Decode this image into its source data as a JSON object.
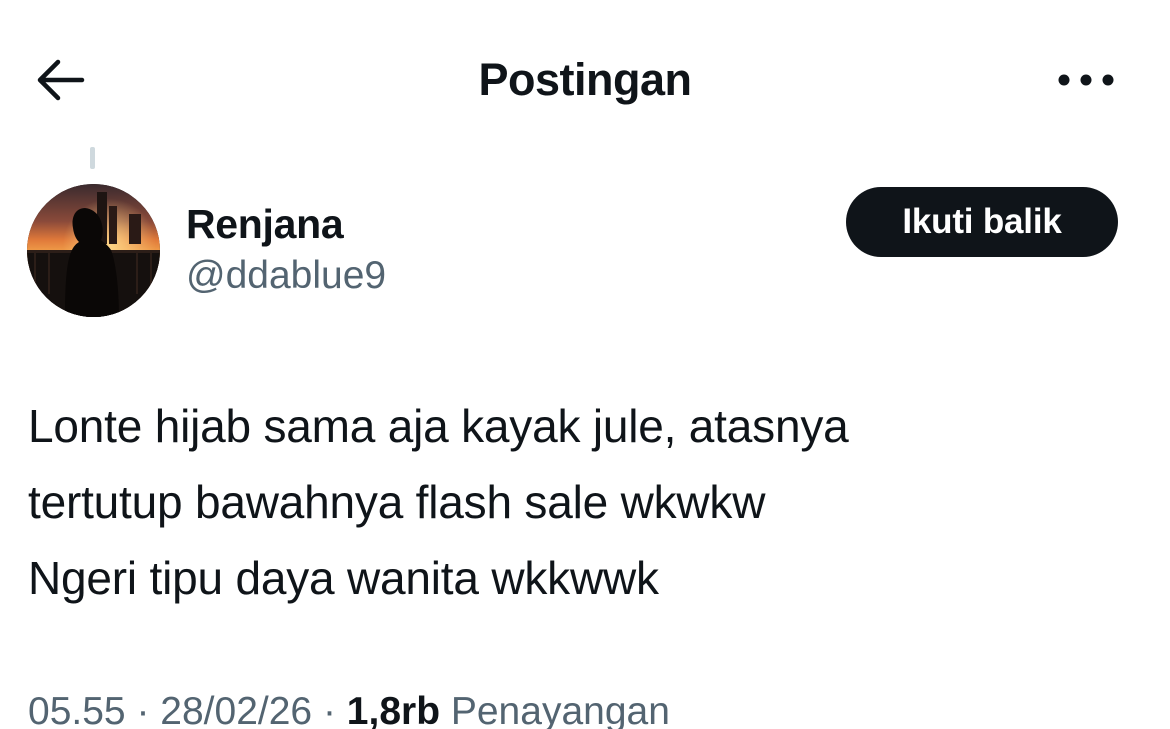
{
  "header": {
    "title": "Postingan",
    "back_icon": "arrow-left-icon",
    "more_icon": "more-horizontal-icon"
  },
  "author": {
    "display_name": "Renjana",
    "handle": "@ddablue9",
    "avatar": "sunset-silhouette-avatar"
  },
  "follow_button": {
    "label": "Ikuti balik"
  },
  "tweet": {
    "lines": [
      "Lonte hijab sama aja kayak jule, atasnya",
      "tertutup bawahnya flash sale wkwkw",
      "Ngeri tipu daya wanita wkkwwk"
    ]
  },
  "meta": {
    "time": "05.55",
    "separator": "·",
    "date": "28/02/26",
    "views_count": "1,8rb",
    "views_label": "Penayangan"
  },
  "colors": {
    "text_primary": "#0f1419",
    "text_secondary": "#536471",
    "button_bg": "#0f1419",
    "thread_line": "#cfd9de"
  }
}
